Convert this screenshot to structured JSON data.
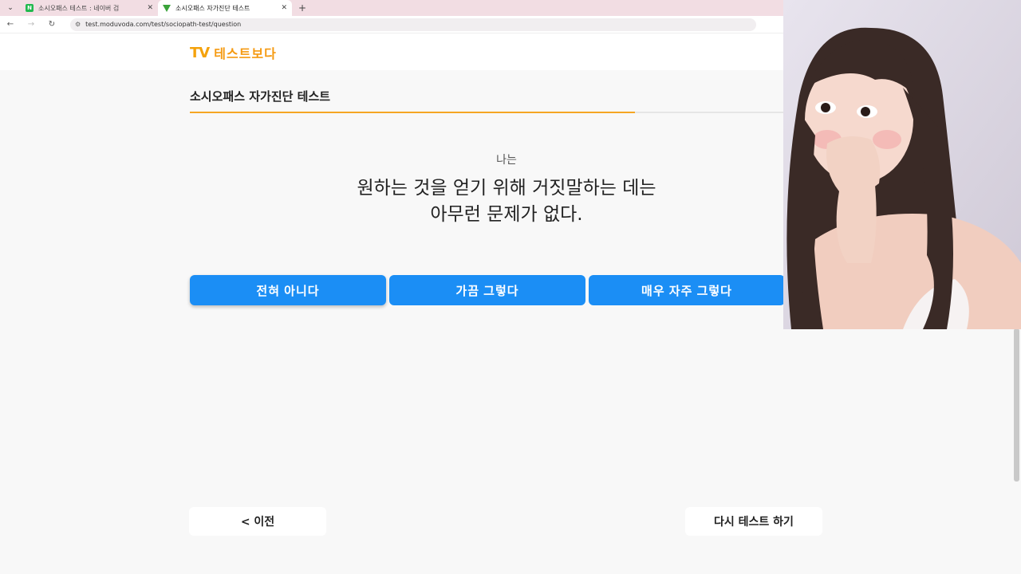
{
  "browser": {
    "tabs": [
      {
        "title": "소시오패스 테스트 : 네이버 검",
        "close": "✕",
        "active": false
      },
      {
        "title": "소시오패스 자가진단 테스트",
        "close": "✕",
        "active": true
      }
    ],
    "new_tab": "+",
    "url": "test.moduvoda.com/test/sociopath-test/question"
  },
  "site": {
    "logo_tv": "TV",
    "logo_text": "테스트보다"
  },
  "test": {
    "title": "소시오패스 자가진단 테스트",
    "progress": 0.75,
    "question_prefix": "나는",
    "question_line1": "원하는 것을 얻기 위해 거짓말하는 데는",
    "question_line2": "아무런 문제가 없다.",
    "answers": [
      "전혀 아니다",
      "가끔 그렇다",
      "매우 자주 그렇다"
    ],
    "prev_label": "< 이전",
    "retry_label": "다시 테스트 하기"
  },
  "colors": {
    "accent_blue": "#1b8ef5",
    "progress_orange": "#f5a623",
    "logo_orange": "#f59a12"
  }
}
